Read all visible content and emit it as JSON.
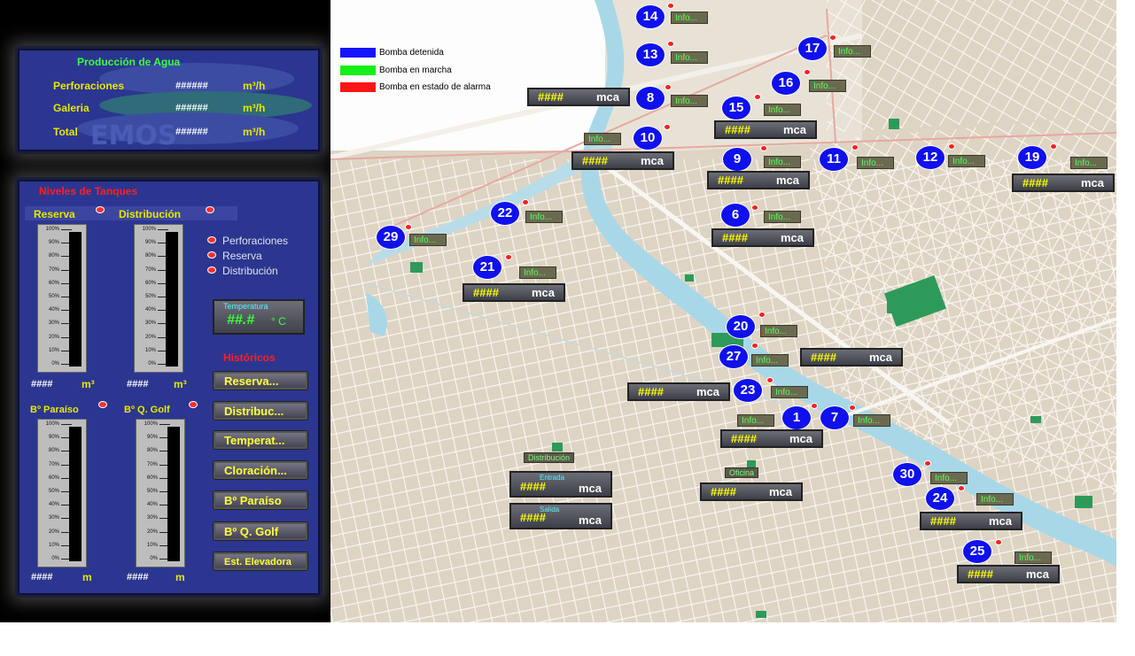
{
  "production": {
    "title": "Producción de Agua",
    "rows": [
      {
        "label": "Perforaciones",
        "value": "######",
        "unit": "m³/h"
      },
      {
        "label": "Galeria",
        "value": "######",
        "unit": "m³/h"
      },
      {
        "label": "Total",
        "value": "######",
        "unit": "m³/h"
      }
    ]
  },
  "tanks": {
    "title": "Niveles de Tanques",
    "gauges": [
      {
        "label": "Reserva",
        "value": "####",
        "unit": "m³"
      },
      {
        "label": "Distribución",
        "value": "####",
        "unit": "m³"
      },
      {
        "label": "Bº Paraíso",
        "value": "####",
        "unit": "m"
      },
      {
        "label": "Bº Q. Golf",
        "value": "####",
        "unit": "m"
      }
    ],
    "ticks": [
      "100%",
      "90%",
      "80%",
      "70%",
      "60%",
      "50%",
      "40%",
      "30%",
      "20%",
      "10%",
      "0%"
    ],
    "alarms": [
      "Perforaciones",
      "Reserva",
      "Distribución"
    ],
    "temperature": {
      "label": "Temperatura",
      "value": "##.#",
      "unit": "° C"
    },
    "historicos_title": "Históricos",
    "buttons": [
      "Reserva...",
      "Distribuc...",
      "Temperat...",
      "Cloración...",
      "Bº Paraíso",
      "Bº Q. Golf",
      "Est. Elevadora"
    ]
  },
  "legend": [
    {
      "label": "Bomba detenida",
      "color": "#1414ff"
    },
    {
      "label": "Bomba en marcha",
      "color": "#14f014"
    },
    {
      "label": "Bomba en estado de alarma",
      "color": "#ff1414"
    }
  ],
  "map": {
    "info_label": "Info...",
    "mca_value": "####",
    "mca_unit": "mca",
    "stations": [
      {
        "n": "14"
      },
      {
        "n": "13"
      },
      {
        "n": "8"
      },
      {
        "n": "10"
      },
      {
        "n": "17"
      },
      {
        "n": "16"
      },
      {
        "n": "15"
      },
      {
        "n": "9"
      },
      {
        "n": "11"
      },
      {
        "n": "12"
      },
      {
        "n": "19"
      },
      {
        "n": "6"
      },
      {
        "n": "22"
      },
      {
        "n": "29"
      },
      {
        "n": "21"
      },
      {
        "n": "20"
      },
      {
        "n": "27"
      },
      {
        "n": "23"
      },
      {
        "n": "1"
      },
      {
        "n": "7"
      },
      {
        "n": "30"
      },
      {
        "n": "24"
      },
      {
        "n": "25"
      }
    ],
    "station_titles": {
      "distribucion": "Distribución",
      "entrada": "Entrada",
      "salida": "Salida",
      "oficina": "Oficina"
    }
  }
}
